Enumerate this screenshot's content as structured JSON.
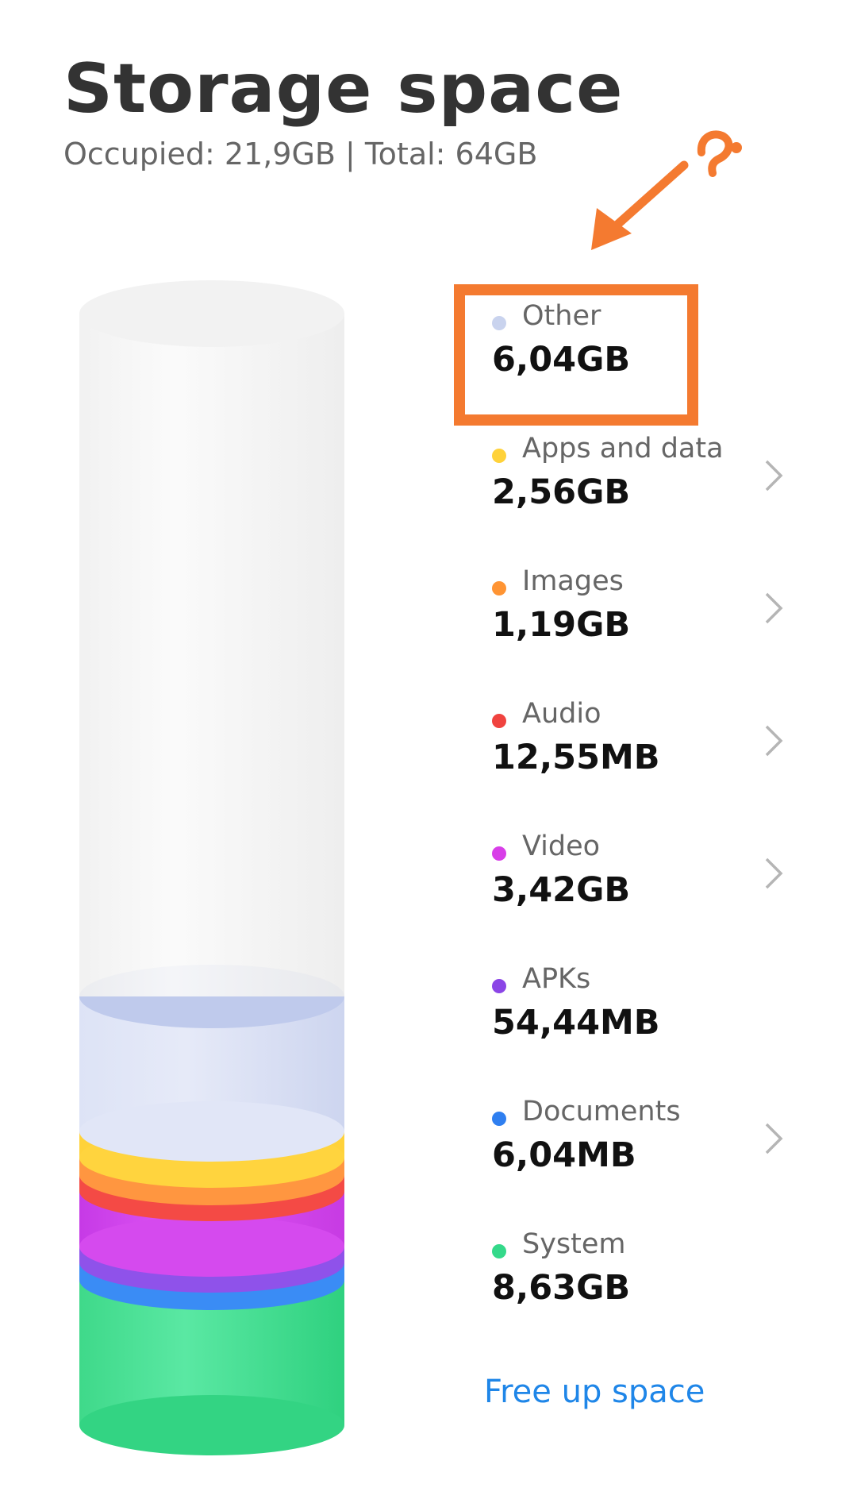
{
  "header": {
    "title": "Storage space",
    "subtitle": "Occupied: 21,9GB | Total: 64GB"
  },
  "categories": [
    {
      "name": "Other",
      "size": "6,04GB",
      "color": "#c9d3ee",
      "has_chevron": false
    },
    {
      "name": "Apps and data",
      "size": "2,56GB",
      "color": "#ffd23a",
      "has_chevron": true
    },
    {
      "name": "Images",
      "size": "1,19GB",
      "color": "#ff9433",
      "has_chevron": true
    },
    {
      "name": "Audio",
      "size": "12,55MB",
      "color": "#f0433f",
      "has_chevron": true
    },
    {
      "name": "Video",
      "size": "3,42GB",
      "color": "#d83ee8",
      "has_chevron": true
    },
    {
      "name": "APKs",
      "size": "54,44MB",
      "color": "#8b45e6",
      "has_chevron": false
    },
    {
      "name": "Documents",
      "size": "6,04MB",
      "color": "#2f7ff0",
      "has_chevron": true
    },
    {
      "name": "System",
      "size": "8,63GB",
      "color": "#34d98a",
      "has_chevron": false
    }
  ],
  "actions": {
    "free_up_label": "Free up space"
  },
  "icons": {
    "chevron": "chevron-right-icon",
    "annotation_arrow": "arrow-icon",
    "annotation_question": "question-mark-icon"
  },
  "annotation": {
    "highlight_color": "#f47a30",
    "highlighted_item": "Other"
  }
}
